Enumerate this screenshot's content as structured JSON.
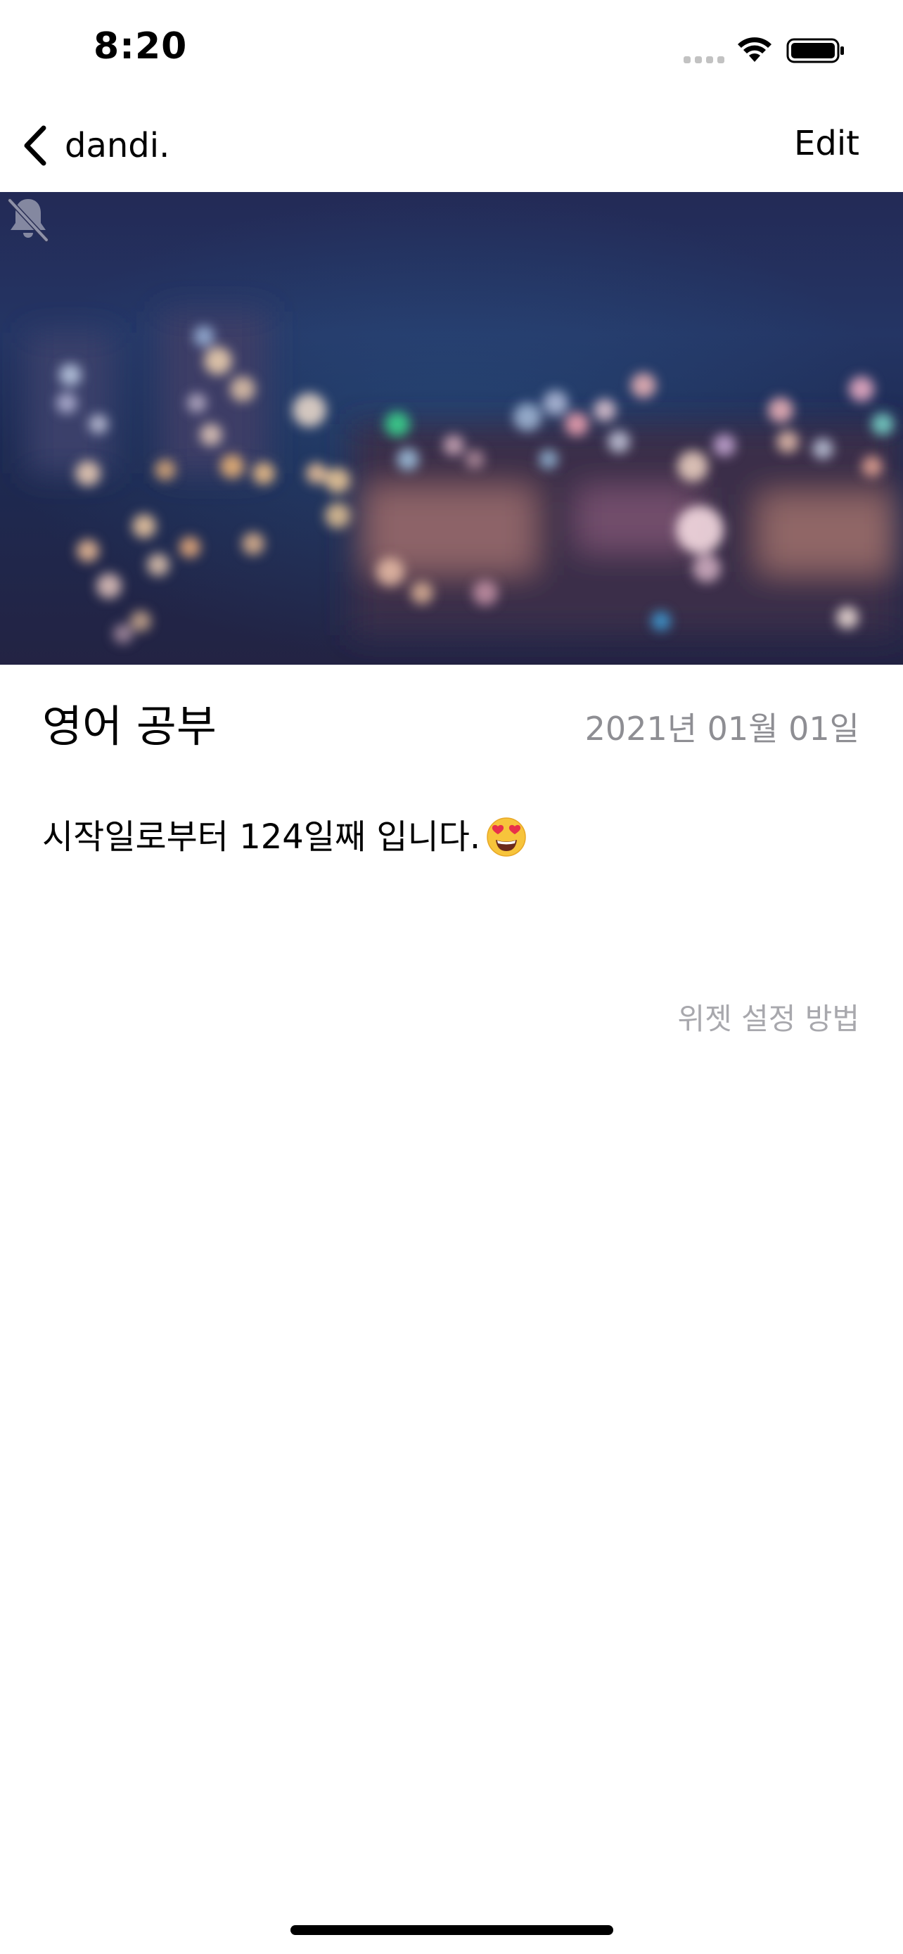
{
  "status_bar": {
    "time": "8:20"
  },
  "nav": {
    "back_label": "dandi.",
    "edit_label": "Edit"
  },
  "hero": {
    "mute_icon": "bell-slash-icon"
  },
  "detail": {
    "title": "영어 공부",
    "start_date": "2021년 01월 01일",
    "dday_text": "시작일로부터 124일째 입니다.",
    "emoji": "heart-eyes-emoji",
    "widget_help_label": "위젯 설정 방법"
  },
  "colors": {
    "secondary_text": "#8e8e93",
    "muted_text": "#a8a8ad"
  }
}
